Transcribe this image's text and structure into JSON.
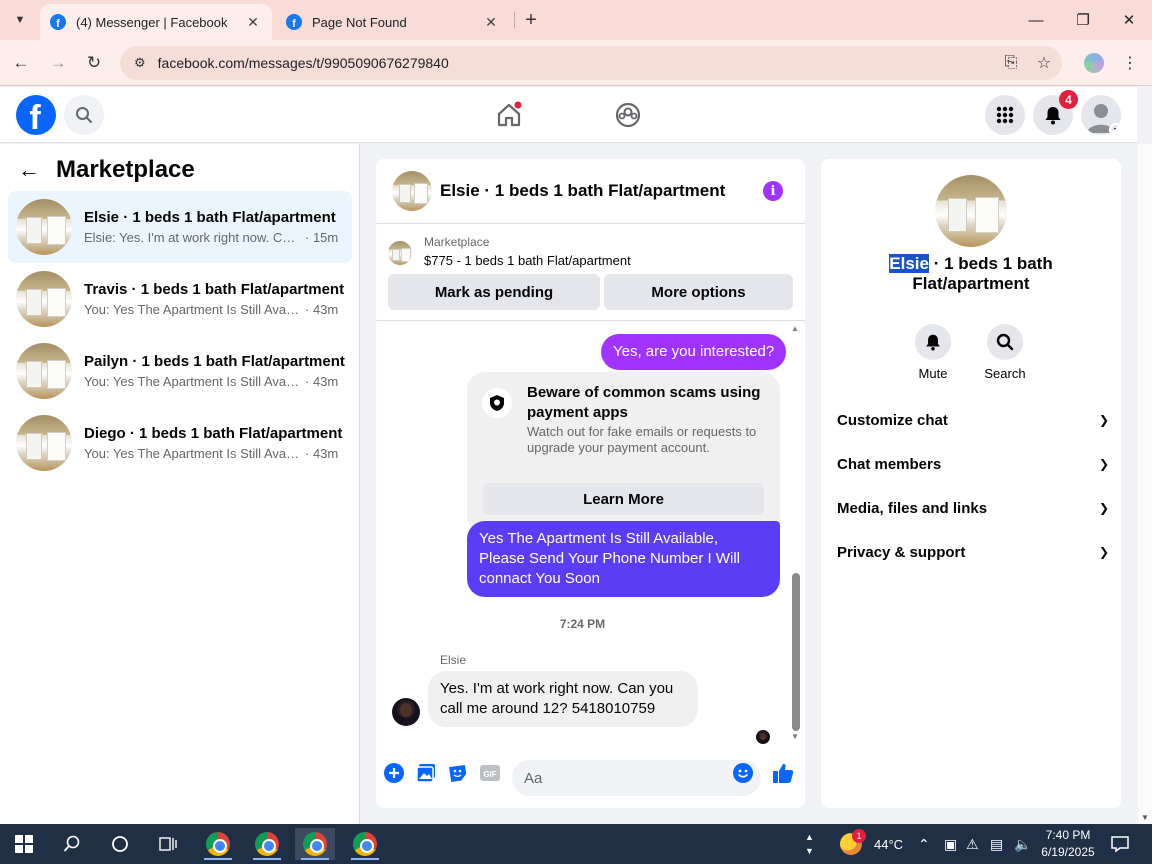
{
  "browser": {
    "tabs": [
      {
        "title": "(4) Messenger | Facebook",
        "active": true,
        "icon": "facebook-icon"
      },
      {
        "title": "Page Not Found",
        "active": false,
        "icon": "facebook-icon"
      }
    ],
    "url": "facebook.com/messages/t/9905090676279840"
  },
  "fb": {
    "notification_count": "4"
  },
  "left": {
    "title": "Marketplace",
    "conversations": [
      {
        "name": "Elsie · 1 beds 1 bath Flat/apartment",
        "preview": "Elsie: Yes. I'm at work right now. Can...",
        "time": "· 15m",
        "selected": true
      },
      {
        "name": "Travis · 1 beds 1 bath Flat/apartment",
        "preview": "You: Yes The Apartment Is Still Avail...",
        "time": "· 43m",
        "selected": false
      },
      {
        "name": "Pailyn · 1 beds 1 bath Flat/apartment",
        "preview": "You: Yes The Apartment Is Still Avail...",
        "time": "· 43m",
        "selected": false
      },
      {
        "name": "Diego · 1 beds 1 bath Flat/apartment",
        "preview": "You: Yes The Apartment Is Still Avail...",
        "time": "· 43m",
        "selected": false
      }
    ]
  },
  "chat": {
    "title": "Elsie · 1 beds 1 bath Flat/apartment",
    "marketplace_label": "Marketplace",
    "listing": "$775 - 1 beds 1 bath Flat/apartment",
    "mark_pending": "Mark as pending",
    "more_options": "More options",
    "messages": {
      "out1": "Yes, are you interested?",
      "scam_title": "Beware of common scams using payment apps",
      "scam_desc": "Watch out for fake emails or requests to upgrade your payment account.",
      "learn_more": "Learn More",
      "out2": "Yes The Apartment Is Still Available, Please Send Your Phone Number I Will connact You Soon",
      "timestamp": "7:24 PM",
      "sender": "Elsie",
      "in1": "Yes. I'm at work right now. Can you call me around 12? 5418010759"
    },
    "composer_placeholder": "Aa",
    "colors": {
      "bubble_purple": "#a033ff",
      "bubble_blue": "#5b3df5",
      "accent": "#0866ff"
    }
  },
  "right": {
    "name_highlight": "Elsie",
    "name_rest": " · 1 beds 1 bath Flat/apartment",
    "actions": [
      {
        "label": "Mute",
        "icon": "bell-icon"
      },
      {
        "label": "Search",
        "icon": "search-icon"
      }
    ],
    "sections": [
      "Customize chat",
      "Chat members",
      "Media, files and links",
      "Privacy & support"
    ]
  },
  "taskbar": {
    "weather_temp": "44°C",
    "weather_badge": "1",
    "time": "7:40 PM",
    "date": "6/19/2025"
  }
}
